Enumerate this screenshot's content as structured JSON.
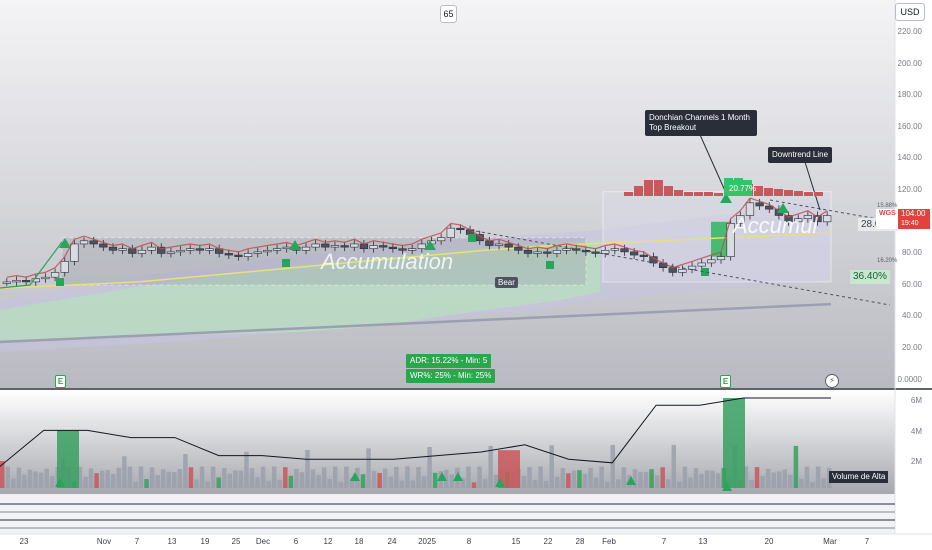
{
  "header": {
    "interval_badge": "65",
    "currency_badge": "USD"
  },
  "annotations": {
    "donchian": "Donchian Channels 1 Month\nTop Breakout",
    "downtrend": "Downtrend Line",
    "accumulation_left": "Accumulation",
    "accumulation_right": "Accumul",
    "bear": "Bear",
    "adr": "ADR: 15.22% - Min: 5",
    "wr": "WR%: 25% - Min: 25%",
    "volume_label": "Volume de Alta",
    "pct_28": "28.07%",
    "pct_36": "36.40%",
    "pct_small_top": "15.88%",
    "pct_small_bottom": "16.20%"
  },
  "price_tag": {
    "symbol": "WGS",
    "price": "104.00",
    "countdown": "19:40"
  },
  "icons": {
    "earnings": "E",
    "lightning": "lightning-icon"
  },
  "colors": {
    "up": "#26a65b",
    "down": "#c24e4e",
    "price_tag": "#e2413d",
    "band_green": "#b7dfbf",
    "band_purple": "#c7c3e2",
    "sma": "#9aa0b0",
    "yellow_ma": "#e8e07a"
  },
  "chart_data": {
    "type": "candlestick",
    "price_axis": {
      "ticks": [
        "220.00",
        "200.00",
        "180.00",
        "160.00",
        "140.00",
        "120.00",
        "100.00",
        "80.00",
        "60.00",
        "40.00",
        "20.00",
        "0.0000"
      ],
      "ylim": [
        0,
        220
      ]
    },
    "volume_axis": {
      "ticks": [
        "6M",
        "4M",
        "2M"
      ]
    },
    "x_ticks": [
      "23",
      "Nov",
      "7",
      "13",
      "19",
      "25",
      "Dec",
      "6",
      "12",
      "18",
      "24",
      "2025",
      "8",
      "15",
      "22",
      "28",
      "Feb",
      "7",
      "13",
      "20",
      "Mar",
      "7"
    ],
    "close_series": [
      62,
      63,
      62,
      64,
      65,
      68,
      75,
      86,
      88,
      86,
      84,
      82,
      83,
      80,
      82,
      84,
      80,
      81,
      82,
      83,
      82,
      83,
      80,
      79,
      78,
      80,
      81,
      82,
      83,
      84,
      82,
      84,
      86,
      84,
      85,
      84,
      86,
      83,
      85,
      84,
      83,
      82,
      83,
      86,
      88,
      90,
      96,
      95,
      92,
      88,
      85,
      86,
      84,
      82,
      80,
      81,
      80,
      82,
      83,
      82,
      81,
      80,
      82,
      83,
      81,
      79,
      78,
      74,
      71,
      68,
      70,
      72,
      74,
      76,
      78,
      99,
      104,
      112,
      110,
      108,
      104,
      100,
      102,
      104,
      100,
      104
    ],
    "moving_averages": {
      "sma_long": [
        24,
        26,
        28,
        30,
        32,
        34,
        36,
        38,
        40,
        42,
        44,
        46,
        48
      ],
      "yellow": [
        58,
        60,
        62,
        66,
        70,
        74,
        78,
        82,
        85,
        87,
        89,
        91,
        93
      ]
    },
    "volume_close_line_M": [
      1.2,
      3.2,
      3.2,
      2.8,
      2.8,
      1.8,
      1.8,
      1.6,
      1.6,
      1.6,
      1.8,
      2.0,
      2.4,
      1.6,
      1.4,
      4.6,
      4.6,
      5.0,
      5.0,
      5.0
    ],
    "accumulation_zones": [
      {
        "start": "Nov",
        "end": "Feb",
        "low": 60,
        "high": 90
      },
      {
        "start": "Feb",
        "end": "Mar",
        "low": 62,
        "high": 119
      }
    ]
  }
}
